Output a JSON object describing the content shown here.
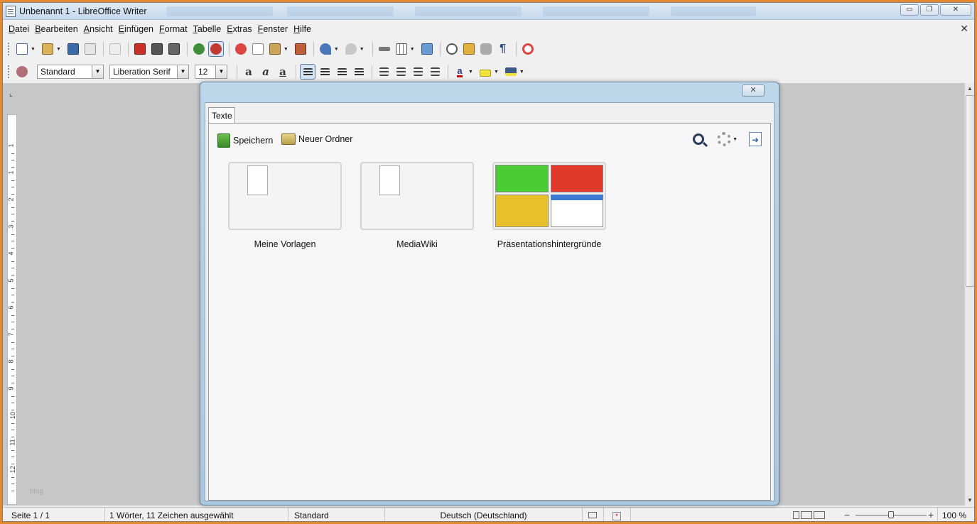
{
  "window": {
    "title": "Unbenannt 1 - LibreOffice Writer",
    "buttons": {
      "minimize": "▭",
      "maximize": "❐",
      "close": "✕"
    }
  },
  "menu": [
    "Datei",
    "Bearbeiten",
    "Ansicht",
    "Einfügen",
    "Format",
    "Tabelle",
    "Extras",
    "Fenster",
    "Hilfe"
  ],
  "document_close": "✕",
  "toolbar_standard": {
    "icons": [
      "new-document-icon",
      "open-icon",
      "save-icon",
      "email-icon",
      "edit-file-icon",
      "export-pdf-icon",
      "print-icon",
      "print-preview-icon",
      "spellcheck-icon",
      "autospellcheck-icon",
      "cut-icon",
      "copy-icon",
      "paste-icon",
      "clone-formatting-icon",
      "undo-icon",
      "redo-icon",
      "hyperlink-icon",
      "table-icon",
      "show-draw-functions-icon",
      "navigator-icon",
      "gallery-icon",
      "data-sources-icon",
      "formatting-marks-icon",
      "help-icon"
    ]
  },
  "toolbar_formatting": {
    "paragraph_style": "Standard",
    "font_name": "Liberation Serif",
    "font_size": "12"
  },
  "dialog": {
    "tab_label": "Texte",
    "save_label": "Speichern",
    "new_folder_label": "Neuer Ordner",
    "close_glyph": "✕",
    "folders": [
      {
        "name": "Meine Vorlagen"
      },
      {
        "name": "MediaWiki"
      },
      {
        "name": "Präsentationshintergründe"
      }
    ],
    "thumb_colors": [
      "#4ccc34",
      "#e23a2a",
      "#e8c12a",
      "#ffffff"
    ]
  },
  "ruler": {
    "marks": [
      "1",
      "1",
      "2",
      "3",
      "4",
      "5",
      "6",
      "7",
      "8",
      "9",
      "10",
      "11",
      "12"
    ]
  },
  "watermark": "blog",
  "status": {
    "page": "Seite 1 / 1",
    "words": "1 Wörter, 11 Zeichen ausgewählt",
    "style": "Standard",
    "language": "Deutsch (Deutschland)",
    "zoom": "100 %",
    "zoom_minus": "−",
    "zoom_plus": "+"
  },
  "colors": {
    "accent_frame": "#e58a2e",
    "dialog_frame": "#a9c6df"
  }
}
